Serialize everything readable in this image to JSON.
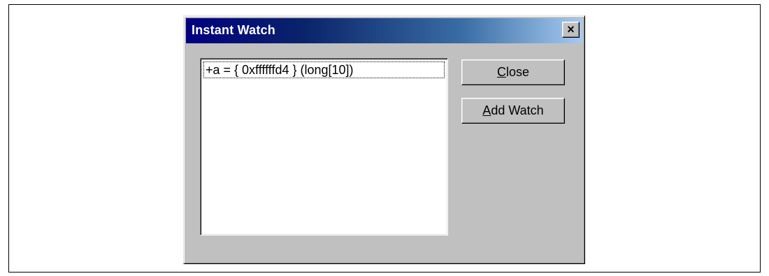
{
  "dialog": {
    "title": "Instant Watch",
    "close_glyph": "×"
  },
  "watch_list": {
    "items": [
      {
        "text": "+a = { 0xffffffd4 } (long[10])"
      }
    ]
  },
  "buttons": {
    "close": {
      "accel": "C",
      "rest": "lose"
    },
    "add_watch": {
      "accel": "A",
      "rest": "dd Watch"
    }
  }
}
